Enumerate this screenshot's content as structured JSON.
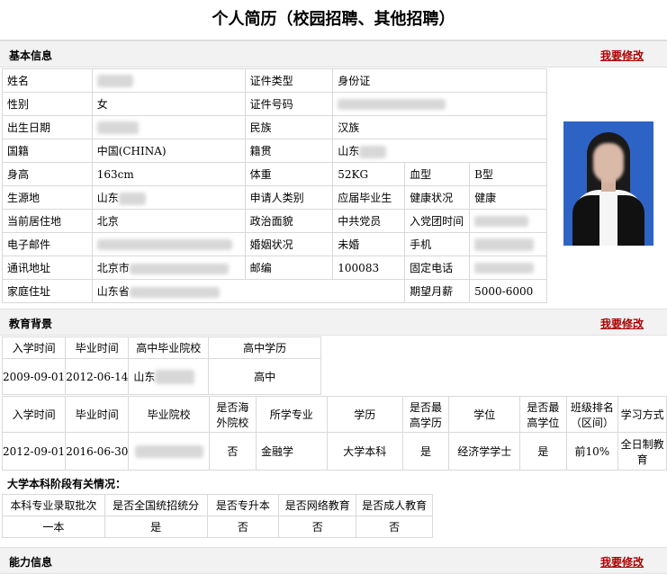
{
  "page_title": "个人简历（校园招聘、其他招聘）",
  "sections": {
    "basic": {
      "title": "基本信息",
      "edit": "我要修改"
    },
    "education": {
      "title": "教育背景",
      "edit": "我要修改"
    },
    "ability": {
      "title": "能力信息",
      "edit": "我要修改"
    }
  },
  "basic": {
    "name_label": "姓名",
    "id_type_label": "证件类型",
    "id_type": "身份证",
    "gender_label": "性别",
    "gender": "女",
    "id_no_label": "证件号码",
    "birth_label": "出生日期",
    "ethnic_label": "民族",
    "ethnic": "汉族",
    "nation_label": "国籍",
    "nation": "中国(CHINA)",
    "native_label": "籍贯",
    "native": "山东",
    "height_label": "身高",
    "height": "163cm",
    "weight_label": "体重",
    "weight": "52KG",
    "blood_label": "血型",
    "blood": "B型",
    "origin_label": "生源地",
    "origin": "山东",
    "applicant_label": "申请人类别",
    "applicant": "应届毕业生",
    "health_label": "健康状况",
    "health": "健康",
    "residence_label": "当前居住地",
    "residence": "北京",
    "political_label": "政治面貌",
    "political": "中共党员",
    "join_label": "入党团时间",
    "email_label": "电子邮件",
    "marital_label": "婚姻状况",
    "marital": "未婚",
    "mobile_label": "手机",
    "address_label": "通讯地址",
    "address": "北京市",
    "postcode_label": "邮编",
    "postcode": "100083",
    "phone_label": "固定电话",
    "home_label": "家庭住址",
    "home": "山东省",
    "salary_label": "期望月薪",
    "salary": "5000-6000"
  },
  "highschool": {
    "headers": [
      "入学时间",
      "毕业时间",
      "高中毕业院校",
      "高中学历"
    ],
    "row": {
      "start": "2009-09-01",
      "end": "2012-06-14",
      "school": "山东",
      "degree": "高中"
    }
  },
  "college": {
    "headers": {
      "start": "入学时间",
      "end": "毕业时间",
      "school": "毕业院校",
      "overseas_1": "是否海",
      "overseas_2": "外院校",
      "major": "所学专业",
      "edu": "学历",
      "highest_1": "是否最",
      "highest_2": "高学历",
      "degree": "学位",
      "highdeg_1": "是否最",
      "highdeg_2": "高学位",
      "rank_1": "班级排名",
      "rank_2": "（区间）",
      "mode": "学习方式"
    },
    "row": {
      "start": "2012-09-01",
      "end": "2016-06-30",
      "overseas": "否",
      "major": "金融学",
      "edu": "大学本科",
      "highest": "是",
      "degree": "经济学学士",
      "highdeg": "是",
      "rank": "前10%",
      "mode_1": "全日制教",
      "mode_2": "育"
    }
  },
  "undergrad": {
    "title": "大学本科阶段有关情况：",
    "headers": [
      "本科专业录取批次",
      "是否全国统招统分",
      "是否专升本",
      "是否网络教育",
      "是否成人教育"
    ],
    "values": [
      "一本",
      "是",
      "否",
      "否",
      "否"
    ]
  },
  "icons": {
    "photo": "profile-photo"
  }
}
